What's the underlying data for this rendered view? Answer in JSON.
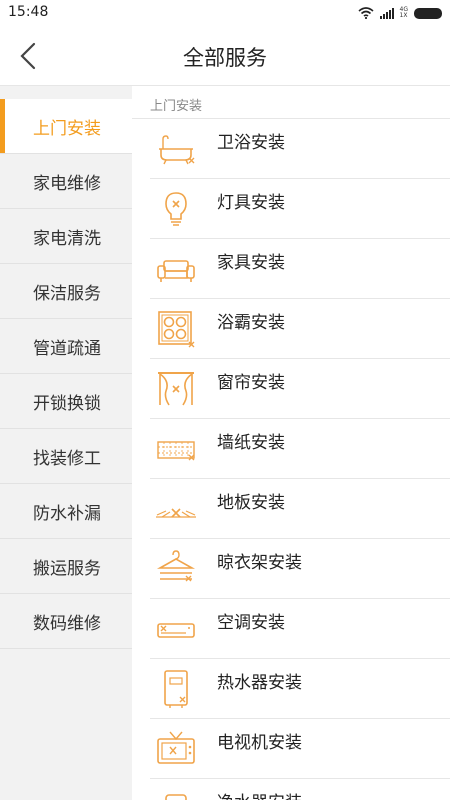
{
  "status": {
    "time": "15:48",
    "net_top": "4G",
    "net_bottom": "1X"
  },
  "header": {
    "title": "全部服务"
  },
  "sidebar": {
    "items": [
      {
        "label": "上门安装"
      },
      {
        "label": "家电维修"
      },
      {
        "label": "家电清洗"
      },
      {
        "label": "保洁服务"
      },
      {
        "label": "管道疏通"
      },
      {
        "label": "开锁换锁"
      },
      {
        "label": "找装修工"
      },
      {
        "label": "防水补漏"
      },
      {
        "label": "搬运服务"
      },
      {
        "label": "数码维修"
      }
    ],
    "active": "上门安装"
  },
  "content": {
    "section_title": "上门安装",
    "items": [
      {
        "label": "卫浴安装",
        "icon": "bathtub-icon"
      },
      {
        "label": "灯具安装",
        "icon": "lightbulb-icon"
      },
      {
        "label": "家具安装",
        "icon": "sofa-icon"
      },
      {
        "label": "浴霸安装",
        "icon": "bath-heater-icon"
      },
      {
        "label": "窗帘安装",
        "icon": "curtain-icon"
      },
      {
        "label": "墙纸安装",
        "icon": "wallpaper-icon"
      },
      {
        "label": "地板安装",
        "icon": "floor-icon"
      },
      {
        "label": "晾衣架安装",
        "icon": "clothes-hanger-icon"
      },
      {
        "label": "空调安装",
        "icon": "air-conditioner-icon"
      },
      {
        "label": "热水器安装",
        "icon": "water-heater-icon"
      },
      {
        "label": "电视机安装",
        "icon": "tv-icon"
      },
      {
        "label": "净水器安装",
        "icon": "water-purifier-icon"
      }
    ]
  },
  "colors": {
    "accent": "#f39c1e",
    "sidebar_bg": "#f2f2f2",
    "icon": "#f0a44a"
  }
}
